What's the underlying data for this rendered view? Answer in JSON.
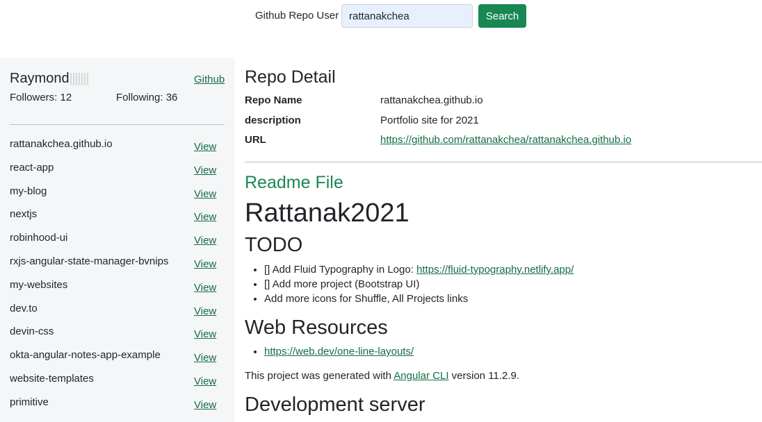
{
  "search": {
    "label": "Github Repo User",
    "value": "rattanakchea",
    "button_label": "Search"
  },
  "sidebar": {
    "user_name": "Raymond",
    "github_link": "Github",
    "followers": "Followers: 12",
    "following": "Following: 36",
    "view_label": "View",
    "repos": [
      {
        "name": "rattanakchea.github.io"
      },
      {
        "name": "react-app"
      },
      {
        "name": "my-blog"
      },
      {
        "name": "nextjs"
      },
      {
        "name": "robinhood-ui"
      },
      {
        "name": "rxjs-angular-state-manager-bvnips"
      },
      {
        "name": "my-websites"
      },
      {
        "name": "dev.to"
      },
      {
        "name": "devin-css"
      },
      {
        "name": "okta-angular-notes-app-example"
      },
      {
        "name": "website-templates"
      },
      {
        "name": "primitive"
      }
    ]
  },
  "detail": {
    "title": "Repo Detail",
    "repo_name_label": "Repo Name",
    "repo_name": "rattanakchea.github.io",
    "description_label": "description",
    "description": "Portfolio site for 2021",
    "url_label": "URL",
    "url": "https://github.com/rattanakchea/rattanakchea.github.io"
  },
  "readme": {
    "title": "Readme File",
    "h1": "Rattanak2021",
    "todo_heading": "TODO",
    "todo_1_text": "[] Add Fluid Typography in Logo: ",
    "todo_1_link": "https://fluid-typography.netlify.app/",
    "todo_2": "[] Add more project (Bootstrap UI)",
    "todo_3": "Add more icons for Shuffle, All Projects links",
    "web_heading": "Web Resources",
    "web_link": "https://web.dev/one-line-layouts/",
    "gen_before": "This project was generated with ",
    "gen_link": "Angular CLI",
    "gen_after": " version 11.2.9.",
    "dev_heading": "Development server"
  },
  "colors": {
    "accent": "#198754",
    "link": "#146c43",
    "sidebar_bg": "#f5f6f7",
    "input_bg": "#e8f0fe"
  }
}
